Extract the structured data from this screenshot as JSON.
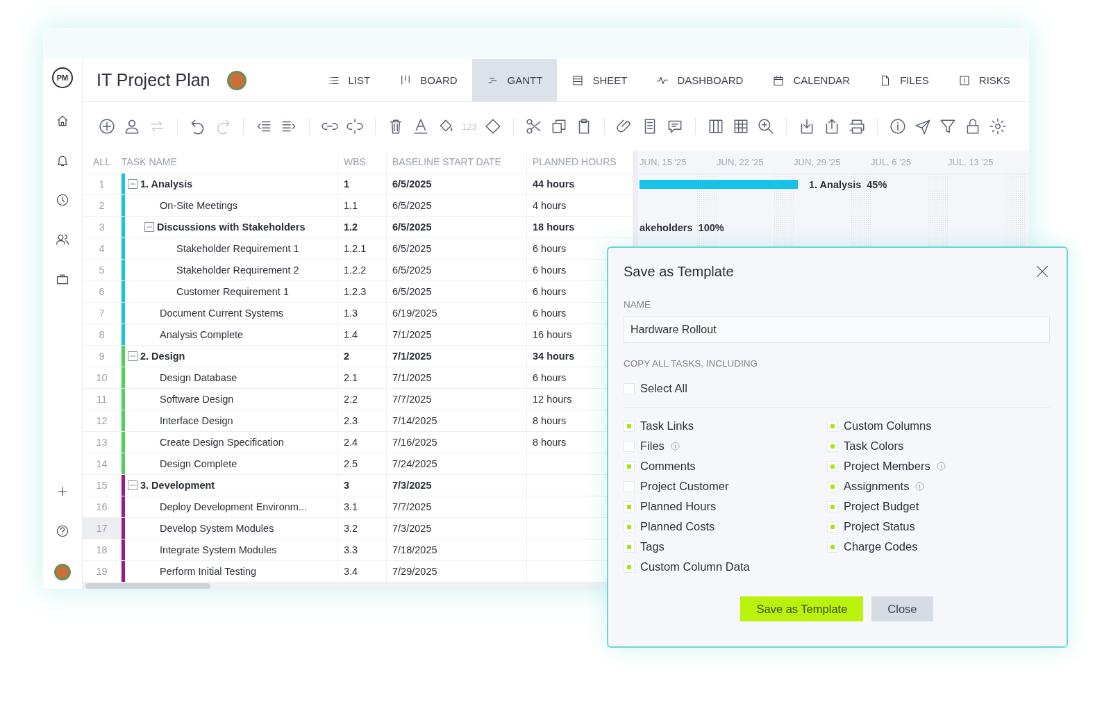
{
  "sidebar": {
    "logo": "PM"
  },
  "header": {
    "title": "IT Project Plan"
  },
  "tabs": [
    {
      "label": "LIST",
      "selected": false
    },
    {
      "label": "BOARD",
      "selected": false
    },
    {
      "label": "GANTT",
      "selected": true
    },
    {
      "label": "SHEET",
      "selected": false
    },
    {
      "label": "DASHBOARD",
      "selected": false
    },
    {
      "label": "CALENDAR",
      "selected": false
    },
    {
      "label": "FILES",
      "selected": false
    },
    {
      "label": "RISKS",
      "selected": false
    }
  ],
  "toolbar": {
    "number_format_label": "123"
  },
  "table": {
    "columns": [
      "ALL",
      "TASK NAME",
      "WBS",
      "BASELINE START DATE",
      "PLANNED HOURS"
    ],
    "tasks": [
      {
        "num": "1",
        "name": "1. Analysis",
        "wbs": "1",
        "start": "6/5/2025",
        "hours": "44 hours",
        "color": "#17c2e8",
        "expanded": true,
        "selected": false,
        "children": [
          {
            "num": "2",
            "name": "On-Site Meetings",
            "wbs": "1.1",
            "start": "6/5/2025",
            "hours": "4 hours",
            "selected": false
          },
          {
            "num": "3",
            "name": "Discussions with Stakeholders",
            "wbs": "1.2",
            "start": "6/5/2025",
            "hours": "18 hours",
            "expanded": true,
            "selected": false,
            "children": [
              {
                "num": "4",
                "name": "Stakeholder Requirement 1",
                "wbs": "1.2.1",
                "start": "6/5/2025",
                "hours": "6 hours",
                "selected": false
              },
              {
                "num": "5",
                "name": "Stakeholder Requirement 2",
                "wbs": "1.2.2",
                "start": "6/5/2025",
                "hours": "6 hours",
                "selected": false
              },
              {
                "num": "6",
                "name": "Customer Requirement 1",
                "wbs": "1.2.3",
                "start": "6/5/2025",
                "hours": "6 hours",
                "selected": false
              }
            ]
          },
          {
            "num": "7",
            "name": "Document Current Systems",
            "wbs": "1.3",
            "start": "6/19/2025",
            "hours": "6 hours",
            "selected": false
          },
          {
            "num": "8",
            "name": "Analysis Complete",
            "wbs": "1.4",
            "start": "7/1/2025",
            "hours": "16 hours",
            "selected": false
          }
        ]
      },
      {
        "num": "9",
        "name": "2. Design",
        "wbs": "2",
        "start": "7/1/2025",
        "hours": "34 hours",
        "color": "#4cd454",
        "expanded": true,
        "selected": false,
        "children": [
          {
            "num": "10",
            "name": "Design Database",
            "wbs": "2.1",
            "start": "7/1/2025",
            "hours": "6 hours",
            "selected": false
          },
          {
            "num": "11",
            "name": "Software Design",
            "wbs": "2.2",
            "start": "7/7/2025",
            "hours": "12 hours",
            "selected": false
          },
          {
            "num": "12",
            "name": "Interface Design",
            "wbs": "2.3",
            "start": "7/14/2025",
            "hours": "8 hours",
            "selected": false
          },
          {
            "num": "13",
            "name": "Create Design Specification",
            "wbs": "2.4",
            "start": "7/16/2025",
            "hours": "8 hours",
            "selected": false
          },
          {
            "num": "14",
            "name": "Design Complete",
            "wbs": "2.5",
            "start": "7/24/2025",
            "selected": false
          }
        ]
      },
      {
        "num": "15",
        "name": "3. Development",
        "wbs": "3",
        "start": "7/3/2025",
        "color": "#9a1a8c",
        "expanded": true,
        "selected": false,
        "children": [
          {
            "num": "16",
            "name": "Deploy Development Environm...",
            "wbs": "3.1",
            "start": "7/7/2025",
            "selected": false
          },
          {
            "num": "17",
            "name": "Develop System Modules",
            "wbs": "3.2",
            "start": "7/3/2025",
            "selected": true
          },
          {
            "num": "18",
            "name": "Integrate System Modules",
            "wbs": "3.3",
            "start": "7/18/2025",
            "selected": false
          },
          {
            "num": "19",
            "name": "Perform Initial Testing",
            "wbs": "3.4",
            "start": "7/29/2025",
            "selected": false
          }
        ]
      }
    ]
  },
  "gantt": {
    "dates": [
      "JUN, 15 '25",
      "JUN, 22 '25",
      "JUN, 29 '25",
      "JUL, 6 '25",
      "JUL, 13 '25"
    ],
    "labels": [
      {
        "name": "1. Analysis",
        "percent": "45%"
      },
      {
        "name": "akeholders",
        "percent": "100%"
      }
    ]
  },
  "dialog": {
    "title": "Save as Template",
    "name_label": "NAME",
    "name_value": "Hardware Rollout",
    "copy_label": "COPY ALL TASKS, INCLUDING",
    "select_all": {
      "label": "Select All",
      "checked": false
    },
    "options_left": [
      {
        "label": "Task Links",
        "checked": true,
        "info": false
      },
      {
        "label": "Files",
        "checked": false,
        "info": true
      },
      {
        "label": "Comments",
        "checked": true,
        "info": false
      },
      {
        "label": "Project Customer",
        "checked": false,
        "info": false
      },
      {
        "label": "Planned Hours",
        "checked": true,
        "info": false
      },
      {
        "label": "Planned Costs",
        "checked": true,
        "info": false
      },
      {
        "label": "Tags",
        "checked": true,
        "info": false
      },
      {
        "label": "Custom Column Data",
        "checked": true,
        "info": false
      }
    ],
    "options_right": [
      {
        "label": "Custom Columns",
        "checked": true,
        "info": false
      },
      {
        "label": "Task Colors",
        "checked": true,
        "info": false
      },
      {
        "label": "Project Members",
        "checked": true,
        "info": true
      },
      {
        "label": "Assignments",
        "checked": true,
        "info": true
      },
      {
        "label": "Project Budget",
        "checked": true,
        "info": false
      },
      {
        "label": "Project Status",
        "checked": true,
        "info": false
      },
      {
        "label": "Charge Codes",
        "checked": true,
        "info": false
      }
    ],
    "buttons": [
      {
        "label": "Save as Template",
        "kind": "primary"
      },
      {
        "label": "Close",
        "kind": "secondary"
      }
    ]
  }
}
